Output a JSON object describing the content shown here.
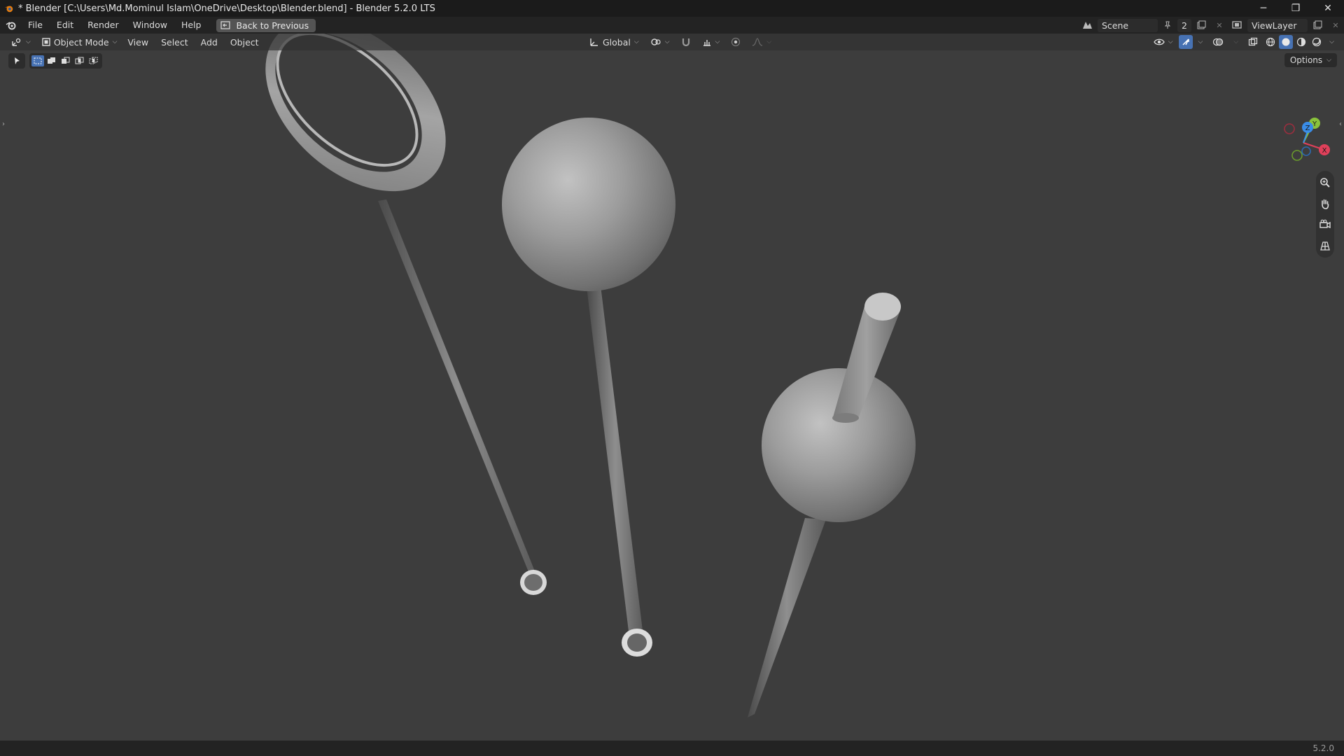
{
  "titlebar": {
    "title": "* Blender [C:\\Users\\Md.Mominul Islam\\OneDrive\\Desktop\\Blender.blend] - Blender 5.2.0 LTS",
    "minimize": "─",
    "maximize": "❐",
    "close": "✕"
  },
  "menubar": {
    "items": [
      "File",
      "Edit",
      "Render",
      "Window",
      "Help"
    ],
    "back_button": "Back to Previous",
    "scene_name": "Scene",
    "scene_users": "2",
    "view_layer": "ViewLayer"
  },
  "header": {
    "mode": "Object Mode",
    "menus": [
      "View",
      "Select",
      "Add",
      "Object"
    ],
    "transform_orientation": "Global"
  },
  "viewport": {
    "options_label": "Options",
    "gizmo": {
      "x": "X",
      "y": "Y",
      "z": "Z"
    }
  },
  "status": {
    "version": "5.2.0"
  },
  "colors": {
    "accent": "#4772b3",
    "axis_x": "#e0405a",
    "axis_y": "#8ac33c",
    "axis_z": "#3a8de8",
    "viewport_bg": "#3d3d3d"
  }
}
